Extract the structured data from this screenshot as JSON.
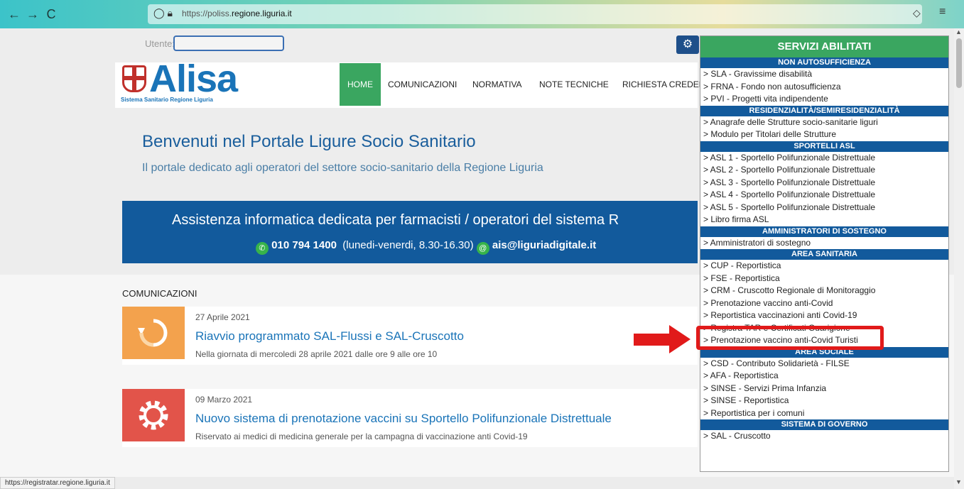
{
  "browser": {
    "back": "←",
    "forward": "→",
    "reload": "C",
    "url_prefix": "https://poliss.",
    "url_domain": "regione.liguria.it",
    "status_url": "https://registratar.regione.liguria.it"
  },
  "topbar": {
    "user_label": "Utente:"
  },
  "logo": {
    "name": "Alisa",
    "subtitle": "Sistema Sanitario Regione Liguria"
  },
  "nav": {
    "home": "HOME",
    "comunicazioni": "COMUNICAZIONI",
    "normativa": "NORMATIVA",
    "note_tecniche": "NOTE TECNICHE",
    "richiesta": "RICHIESTA CREDEN"
  },
  "hero": {
    "title": "Benvenuti nel Portale Ligure Socio Sanitario",
    "subtitle": "Il portale dedicato agli operatori del settore socio-sanitario della Regione Liguria"
  },
  "banner": {
    "title": "Assistenza informatica dedicata per farmacisti / operatori del sistema R",
    "phone": "010 794 1400",
    "hours": "(lunedi-venerdi, 8.30-16.30)",
    "email": "ais@liguriadigitale.it"
  },
  "comunicazioni": {
    "heading": "COMUNICAZIONI",
    "items": [
      {
        "date": "27 Aprile 2021",
        "title": "Riavvio programmato SAL-Flussi e SAL-Cruscotto",
        "desc": "Nella giornata di mercoledi 28 aprile 2021 dalle ore 9 alle ore 10"
      },
      {
        "date": "09 Marzo 2021",
        "title": "Nuovo sistema di prenotazione vaccini su Sportello Polifunzionale Distrettuale",
        "desc": "Riservato ai medici di medicina generale per la campagna di vaccinazione anti Covid-19"
      }
    ]
  },
  "services": {
    "header": "SERVIZI ABILITATI",
    "sections": [
      {
        "title": "NON AUTOSUFFICIENZA",
        "items": [
          "> SLA - Gravissime disabilità",
          "> FRNA - Fondo non autosufficienza",
          "> PVI - Progetti vita indipendente"
        ]
      },
      {
        "title": "RESIDENZIALITÀ/SEMIRESIDENZIALITÀ",
        "items": [
          "> Anagrafe delle Strutture socio-sanitarie liguri",
          "> Modulo per Titolari delle Strutture"
        ]
      },
      {
        "title": "SPORTELLI ASL",
        "items": [
          "> ASL 1 - Sportello Polifunzionale Distrettuale",
          "> ASL 2 - Sportello Polifunzionale Distrettuale",
          "> ASL 3 - Sportello Polifunzionale Distrettuale",
          "> ASL 4 - Sportello Polifunzionale Distrettuale",
          "> ASL 5 - Sportello Polifunzionale Distrettuale",
          "> Libro firma ASL"
        ]
      },
      {
        "title": "AMMINISTRATORI DI SOSTEGNO",
        "items": [
          "> Amministratori di sostegno"
        ]
      },
      {
        "title": "AREA SANITARIA",
        "items": [
          "> CUP - Reportistica",
          "> FSE - Reportistica",
          "> CRM - Cruscotto Regionale di Monitoraggio",
          "> Prenotazione vaccino anti-Covid",
          "> Reportistica vaccinazioni anti Covid-19",
          "> Registra TAR e Certificati Guarigione",
          "> Prenotazione vaccino anti-Covid Turisti"
        ]
      },
      {
        "title": "AREA SOCIALE",
        "items": [
          "> CSD - Contributo Solidarietà - FILSE",
          "> AFA - Reportistica",
          "> SINSE - Servizi Prima Infanzia",
          "> SINSE - Reportistica",
          "> Reportistica per i comuni"
        ]
      },
      {
        "title": "SISTEMA DI GOVERNO",
        "items": [
          "> SAL - Cruscotto"
        ]
      }
    ]
  },
  "icons": {
    "pocket": "pocket-icon",
    "menu": "hamburger-menu-icon",
    "star": "bookmark-star-icon",
    "settings": "gears-icon",
    "phone": "phone-icon",
    "at": "at-icon",
    "sync": "sync-icon",
    "gear": "gear-icon"
  },
  "colors": {
    "brand_blue": "#125a9c",
    "green": "#3aa660",
    "highlight_red": "#e11a1a",
    "card_orange": "#f3a24d",
    "card_red": "#e2544a"
  }
}
